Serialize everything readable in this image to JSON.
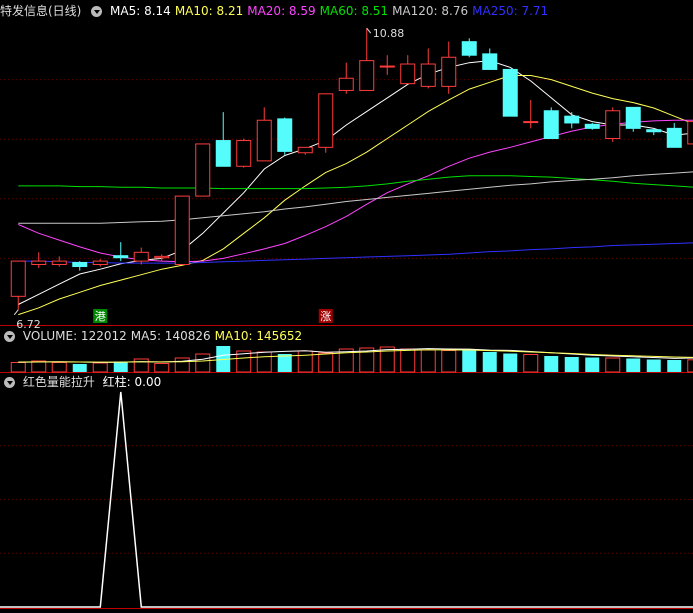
{
  "colors": {
    "up": "#ff3c3c",
    "down": "#54fcfc",
    "ma5": "#ffffff",
    "ma10": "#ffff55",
    "ma20": "#ff44ff",
    "ma60": "#00e000",
    "ma120": "#c8c8c8",
    "ma250": "#3030ff",
    "separator": "#c00000"
  },
  "price_panel": {
    "title": "特发信息(日线)",
    "ma_labels": [
      {
        "text": "MA5: 8.14",
        "color": "#ffffff"
      },
      {
        "text": "MA10: 8.21",
        "color": "#ffff55"
      },
      {
        "text": "MA20: 8.59",
        "color": "#ff44ff"
      },
      {
        "text": "MA60: 8.51",
        "color": "#00e000"
      },
      {
        "text": "MA120: 8.76",
        "color": "#c8c8c8"
      },
      {
        "text": "MA250: 7.71",
        "color": "#3030ff"
      }
    ],
    "high_label": "10.88",
    "low_label": "6.72",
    "markers": [
      {
        "text": "港",
        "index": 4,
        "bg": "#008800"
      },
      {
        "text": "涨",
        "index": 15,
        "bg": "#a00000"
      }
    ]
  },
  "volume_panel": {
    "labels": [
      {
        "text": "VOLUME: 122012",
        "color": "#dddddd"
      },
      {
        "text": "MA5: 140826",
        "color": "#dddddd"
      },
      {
        "text": "MA10: 145652",
        "color": "#ffff55"
      }
    ]
  },
  "indicator_panel": {
    "title": "红色量能拉升",
    "value_label": "红柱: 0.00"
  },
  "chart_data": {
    "type": "candlestick",
    "price_range": [
      6.6,
      11.0
    ],
    "candles": [
      {
        "o": 6.92,
        "c": 7.44,
        "h": 7.44,
        "l": 6.72
      },
      {
        "o": 7.39,
        "c": 7.44,
        "h": 7.57,
        "l": 7.34
      },
      {
        "o": 7.39,
        "c": 7.44,
        "h": 7.51,
        "l": 7.36
      },
      {
        "o": 7.42,
        "c": 7.36,
        "h": 7.44,
        "l": 7.3
      },
      {
        "o": 7.39,
        "c": 7.44,
        "h": 7.47,
        "l": 7.36
      },
      {
        "o": 7.52,
        "c": 7.49,
        "h": 7.72,
        "l": 7.44
      },
      {
        "o": 7.44,
        "c": 7.57,
        "h": 7.64,
        "l": 7.39
      },
      {
        "o": 7.49,
        "c": 7.51,
        "h": 7.54,
        "l": 7.44
      },
      {
        "o": 7.39,
        "c": 8.4,
        "h": 8.4,
        "l": 7.39
      },
      {
        "o": 8.4,
        "c": 9.17,
        "h": 9.17,
        "l": 8.4
      },
      {
        "o": 9.22,
        "c": 8.84,
        "h": 9.64,
        "l": 8.84
      },
      {
        "o": 8.84,
        "c": 9.22,
        "h": 9.25,
        "l": 8.82
      },
      {
        "o": 8.92,
        "c": 9.52,
        "h": 9.71,
        "l": 8.92
      },
      {
        "o": 9.54,
        "c": 9.06,
        "h": 9.56,
        "l": 9.01
      },
      {
        "o": 9.04,
        "c": 9.12,
        "h": 9.12,
        "l": 9.01
      },
      {
        "o": 9.12,
        "c": 9.91,
        "h": 9.91,
        "l": 9.04
      },
      {
        "o": 9.96,
        "c": 10.14,
        "h": 10.37,
        "l": 9.91
      },
      {
        "o": 9.96,
        "c": 10.4,
        "h": 10.88,
        "l": 9.96
      },
      {
        "o": 10.32,
        "c": 10.32,
        "h": 10.48,
        "l": 10.19
      },
      {
        "o": 10.06,
        "c": 10.35,
        "h": 10.48,
        "l": 10.06
      },
      {
        "o": 10.02,
        "c": 10.35,
        "h": 10.58,
        "l": 9.99
      },
      {
        "o": 10.02,
        "c": 10.45,
        "h": 10.68,
        "l": 9.91
      },
      {
        "o": 10.68,
        "c": 10.48,
        "h": 10.73,
        "l": 10.45
      },
      {
        "o": 10.5,
        "c": 10.27,
        "h": 10.58,
        "l": 10.27
      },
      {
        "o": 10.27,
        "c": 9.58,
        "h": 10.27,
        "l": 9.58
      },
      {
        "o": 9.5,
        "c": 9.5,
        "h": 9.82,
        "l": 9.4
      },
      {
        "o": 9.66,
        "c": 9.25,
        "h": 9.71,
        "l": 9.25
      },
      {
        "o": 9.58,
        "c": 9.48,
        "h": 9.64,
        "l": 9.4
      },
      {
        "o": 9.46,
        "c": 9.4,
        "h": 9.48,
        "l": 9.38
      },
      {
        "o": 9.25,
        "c": 9.66,
        "h": 9.71,
        "l": 9.2
      },
      {
        "o": 9.71,
        "c": 9.4,
        "h": 9.71,
        "l": 9.35
      },
      {
        "o": 9.38,
        "c": 9.35,
        "h": 9.4,
        "l": 9.3
      },
      {
        "o": 9.4,
        "c": 9.12,
        "h": 9.48,
        "l": 9.12
      },
      {
        "o": 9.17,
        "c": 9.5,
        "h": 9.58,
        "l": 9.17
      }
    ],
    "ma_lines": [
      {
        "name": "MA5",
        "color": "#ffffff",
        "values": [
          6.8,
          6.95,
          7.1,
          7.25,
          7.32,
          7.4,
          7.45,
          7.48,
          7.6,
          7.85,
          8.15,
          8.45,
          8.8,
          9.0,
          9.1,
          9.22,
          9.45,
          9.65,
          9.85,
          10.05,
          10.2,
          10.3,
          10.37,
          10.4,
          10.3,
          10.1,
          9.85,
          9.6,
          9.5,
          9.45,
          9.45,
          9.4,
          9.3,
          9.33
        ]
      },
      {
        "name": "MA10",
        "color": "#ffff55",
        "values": [
          6.65,
          6.75,
          6.88,
          6.98,
          7.08,
          7.16,
          7.24,
          7.32,
          7.38,
          7.45,
          7.62,
          7.85,
          8.08,
          8.34,
          8.55,
          8.75,
          8.88,
          9.05,
          9.25,
          9.45,
          9.65,
          9.82,
          9.98,
          10.08,
          10.18,
          10.18,
          10.12,
          10.02,
          9.92,
          9.84,
          9.78,
          9.7,
          9.58,
          9.46
        ]
      },
      {
        "name": "MA20",
        "color": "#ff44ff",
        "values": [
          7.98,
          7.85,
          7.75,
          7.65,
          7.56,
          7.5,
          7.46,
          7.44,
          7.43,
          7.44,
          7.48,
          7.55,
          7.62,
          7.7,
          7.82,
          7.95,
          8.1,
          8.28,
          8.45,
          8.58,
          8.7,
          8.84,
          8.96,
          9.05,
          9.12,
          9.2,
          9.28,
          9.36,
          9.42,
          9.46,
          9.49,
          9.51,
          9.52,
          9.52
        ]
      },
      {
        "name": "MA60",
        "color": "#00e000",
        "values": [
          8.55,
          8.55,
          8.55,
          8.54,
          8.54,
          8.53,
          8.53,
          8.52,
          8.52,
          8.52,
          8.51,
          8.51,
          8.51,
          8.51,
          8.51,
          8.52,
          8.53,
          8.55,
          8.58,
          8.62,
          8.65,
          8.68,
          8.7,
          8.7,
          8.7,
          8.69,
          8.68,
          8.66,
          8.64,
          8.62,
          8.59,
          8.57,
          8.55,
          8.53
        ]
      },
      {
        "name": "MA120",
        "color": "#c8c8c8",
        "values": [
          8.0,
          8.0,
          8.0,
          8.0,
          8.0,
          8.01,
          8.02,
          8.03,
          8.05,
          8.08,
          8.11,
          8.14,
          8.17,
          8.21,
          8.24,
          8.28,
          8.32,
          8.35,
          8.38,
          8.41,
          8.44,
          8.47,
          8.5,
          8.53,
          8.56,
          8.58,
          8.61,
          8.63,
          8.65,
          8.67,
          8.7,
          8.72,
          8.74,
          8.76
        ]
      },
      {
        "name": "MA250",
        "color": "#3030ff",
        "values": [
          7.44,
          7.44,
          7.43,
          7.42,
          7.42,
          7.41,
          7.41,
          7.41,
          7.41,
          7.42,
          7.43,
          7.44,
          7.45,
          7.46,
          7.47,
          7.48,
          7.49,
          7.5,
          7.51,
          7.52,
          7.53,
          7.54,
          7.56,
          7.58,
          7.59,
          7.61,
          7.62,
          7.64,
          7.65,
          7.67,
          7.68,
          7.69,
          7.7,
          7.71
        ]
      }
    ],
    "volume": {
      "range": [
        0,
        280000
      ],
      "bars": [
        95000,
        110000,
        95000,
        80000,
        90000,
        105000,
        130000,
        85000,
        140000,
        180000,
        260000,
        210000,
        200000,
        180000,
        210000,
        190000,
        230000,
        240000,
        250000,
        230000,
        220000,
        215000,
        230000,
        200000,
        185000,
        175000,
        160000,
        150000,
        145000,
        140000,
        135000,
        125000,
        120000,
        122012
      ],
      "ma5": [
        98000,
        100000,
        102000,
        100000,
        96000,
        98000,
        104000,
        100000,
        108000,
        128000,
        167000,
        183000,
        198000,
        206000,
        212000,
        198000,
        202000,
        210000,
        224000,
        228000,
        234000,
        230000,
        229000,
        219000,
        216000,
        205000,
        192000,
        180000,
        168000,
        160000,
        152000,
        145000,
        136000,
        140826
      ],
      "ma10": [
        100000,
        101000,
        101000,
        100000,
        99000,
        99000,
        101000,
        101000,
        103000,
        110000,
        125000,
        140000,
        153000,
        160000,
        168000,
        180000,
        192000,
        200000,
        210000,
        216000,
        222000,
        220000,
        220000,
        214000,
        208000,
        200000,
        192000,
        185000,
        175000,
        168000,
        162000,
        156000,
        150000,
        145652
      ]
    },
    "indicator": {
      "range": [
        0,
        1
      ],
      "values": [
        0,
        0,
        0,
        0,
        0,
        1,
        0,
        0,
        0,
        0,
        0,
        0,
        0,
        0,
        0,
        0,
        0,
        0,
        0,
        0,
        0,
        0,
        0,
        0,
        0,
        0,
        0,
        0,
        0,
        0,
        0,
        0,
        0,
        0
      ]
    }
  }
}
